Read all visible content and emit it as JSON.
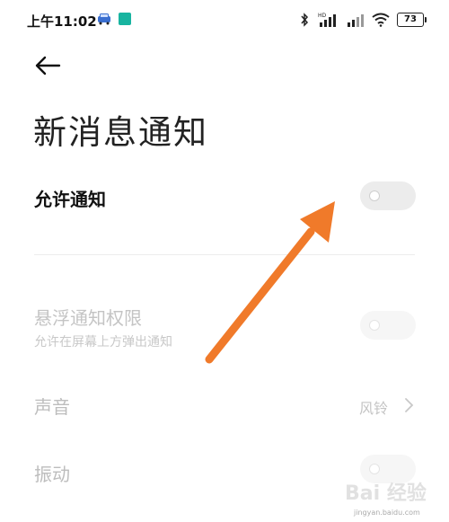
{
  "status_bar": {
    "time": "上午11:02",
    "battery": "73",
    "network_badge": "HD"
  },
  "page": {
    "title": "新消息通知"
  },
  "settings": {
    "allow_notifications": {
      "label": "允许通知",
      "enabled": false
    },
    "floating_permission": {
      "label": "悬浮通知权限",
      "subtitle": "允许在屏幕上方弹出通知",
      "enabled": false,
      "disabled": true
    },
    "sound": {
      "label": "声音",
      "value": "风铃"
    },
    "vibration": {
      "label": "振动",
      "enabled": false,
      "disabled": true
    }
  },
  "annotation": {
    "arrow_color": "#f07a2a"
  },
  "watermark": {
    "text": "Bai 经验",
    "url": "jingyan.baidu.com"
  }
}
